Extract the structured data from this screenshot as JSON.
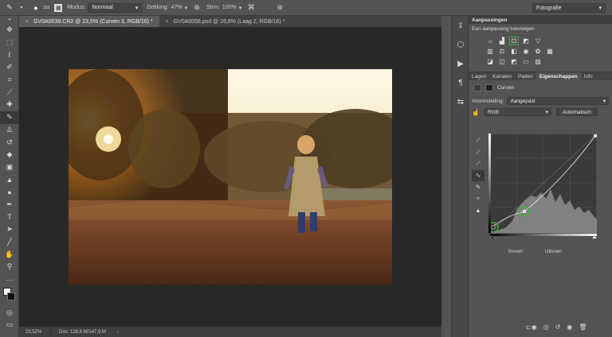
{
  "options_bar": {
    "brush_size": "150",
    "mode_label": "Modus:",
    "mode_value": "Normaal",
    "opacity_label": "Dekking:",
    "opacity_value": "47%",
    "flow_label": "Strm:",
    "flow_value": "100%",
    "workspace": "Fotografie"
  },
  "doc_tabs": [
    {
      "label": "GV0A0038.CR2 @ 23,5% (Curven 3, RGB/16) *",
      "close": "×"
    },
    {
      "label": "GV0A0058.psd @ 26,6% (Laag 2, RGB/16) *",
      "close": "×"
    }
  ],
  "status": {
    "zoom": "23,52%",
    "doc": "Doc: 126,6 M/147,9 M",
    "arrow": "›"
  },
  "adjustments": {
    "title": "Aanpassingen",
    "subtitle": "Een aanpassing toevoegen"
  },
  "panel_tabs": [
    "Lagen",
    "Kanalen",
    "Paden",
    "Eigenschappen",
    "Info"
  ],
  "properties": {
    "layer_type": "Curven",
    "preset_label": "Voorinstelling:",
    "preset_value": "Aangepast",
    "channel_value": "RGB",
    "auto_button": "Automatisch",
    "input_label": "Invoer:",
    "output_label": "Uitvoer:"
  },
  "colors": {
    "accent_green": "#3fae3f",
    "panel_bg": "#535353",
    "canvas_bg": "#282828"
  },
  "icons": {
    "toolbar": [
      "move-icon",
      "marquee-icon",
      "lasso-icon",
      "quick-select-icon",
      "crop-icon",
      "eyedropper-icon",
      "healing-icon",
      "brush-icon",
      "stamp-icon",
      "history-brush-icon",
      "eraser-icon",
      "gradient-icon",
      "blur-icon",
      "dodge-icon",
      "pen-icon",
      "type-icon",
      "path-select-icon",
      "line-icon",
      "hand-icon",
      "zoom-icon",
      "more-icon"
    ]
  }
}
